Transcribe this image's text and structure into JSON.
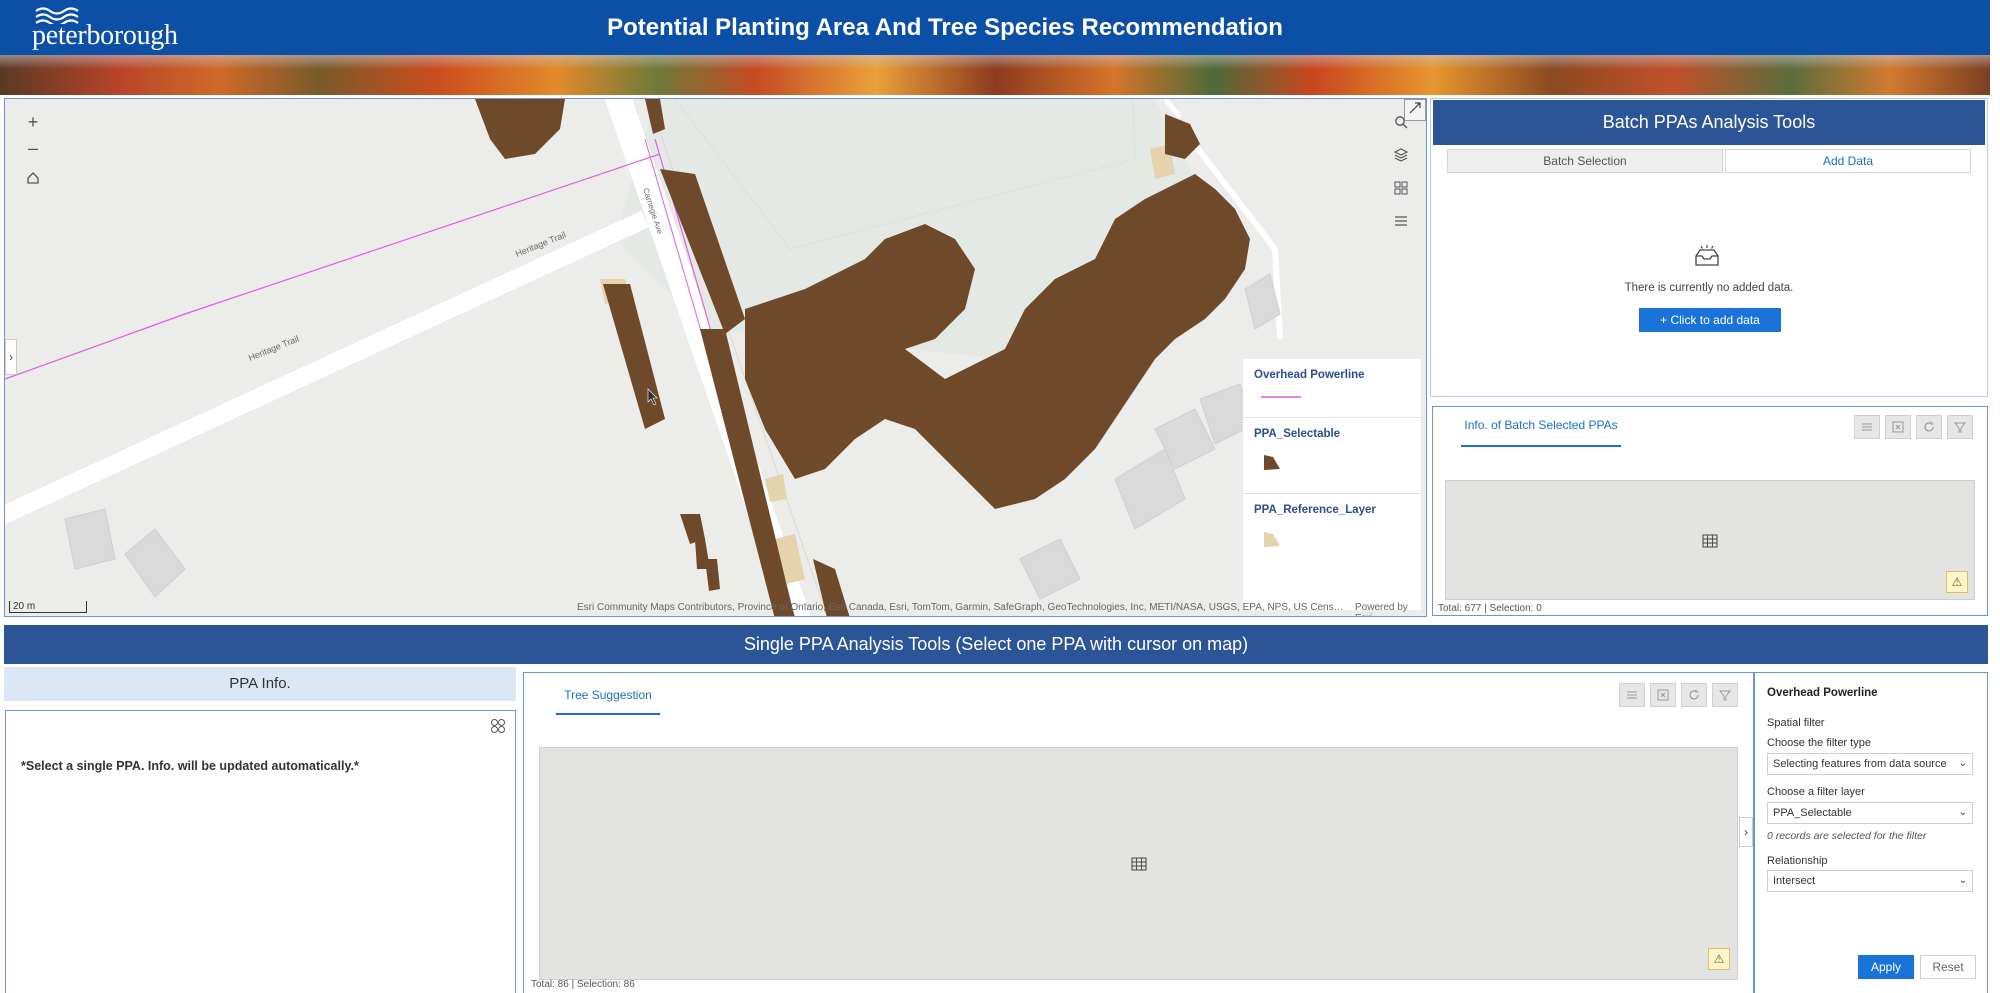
{
  "header": {
    "logo_text": "peterborough",
    "title": "Potential Planting Area And Tree Species Recommendation"
  },
  "map": {
    "zoom_in": "+",
    "zoom_out": "–",
    "side_toggle": "›",
    "road_labels": [
      "Heritage Trail",
      "Heritage Trail",
      "Carnegie Ave"
    ],
    "legend": {
      "items": [
        {
          "label": "Overhead Powerline",
          "color": "#e05fe0"
        },
        {
          "label": "PPA_Selectable",
          "color": "#6e4a2a"
        },
        {
          "label": "PPA_Reference_Layer",
          "color": "#e4d3ad"
        }
      ]
    },
    "scale": "20 m",
    "attribution": "Esri Community Maps Contributors, Province of Ontario, Esri Canada, Esri, TomTom, Garmin, SafeGraph, GeoTechnologies, Inc, METI/NASA, USGS, EPA, NPS, US Census Bureau, US...",
    "powered_by": "Powered by Esri",
    "colors": {
      "ppa_fill": "#6e4a2a",
      "reference_fill": "#e4d3ad",
      "powerline": "#e05fe0",
      "road": "#ffffff",
      "building": "#dcdcdc"
    }
  },
  "batch": {
    "title": "Batch PPAs Analysis Tools",
    "tabs": [
      "Batch Selection",
      "Add Data"
    ],
    "active_tab": "Add Data",
    "empty_text": "There is currently no added data.",
    "add_button": "+  Click to add data",
    "info_tab": "Info. of Batch Selected PPAs",
    "totals": "Total: 677 | Selection: 0"
  },
  "single": {
    "title": "Single PPA Analysis Tools (Select one PPA with cursor on map)",
    "ppa_info_title": "PPA Info.",
    "ppa_message": "*Select a single PPA. Info. will be updated automatically.*",
    "tree_tab": "Tree Suggestion",
    "tree_totals": "Total: 86 | Selection: 86",
    "collapse": "›"
  },
  "filter": {
    "title": "Overhead Powerline",
    "spatial_label": "Spatial filter",
    "type_label": "Choose the filter type",
    "type_value": "Selecting features from data source",
    "layer_label": "Choose a filter layer",
    "layer_value": "PPA_Selectable",
    "records_note": "0 records are selected for the filter",
    "relationship_label": "Relationship",
    "relationship_value": "Intersect",
    "apply": "Apply",
    "reset": "Reset"
  },
  "accent": "#1a73d9",
  "brand": "#0b4fa6"
}
